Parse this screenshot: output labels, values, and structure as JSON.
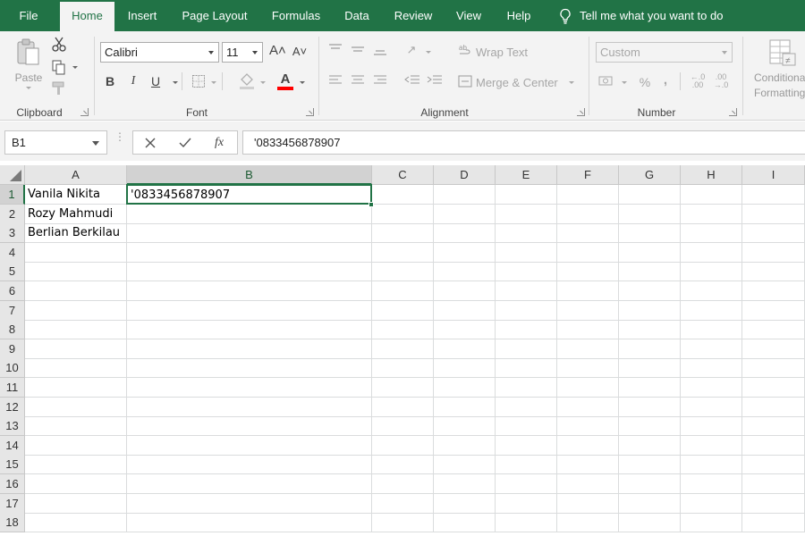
{
  "tabs": [
    {
      "label": "File",
      "active": false
    },
    {
      "label": "Home",
      "active": true
    },
    {
      "label": "Insert",
      "active": false
    },
    {
      "label": "Page Layout",
      "active": false
    },
    {
      "label": "Formulas",
      "active": false
    },
    {
      "label": "Data",
      "active": false
    },
    {
      "label": "Review",
      "active": false
    },
    {
      "label": "View",
      "active": false
    },
    {
      "label": "Help",
      "active": false
    }
  ],
  "tell_me": "Tell me what you want to do",
  "ribbon": {
    "clipboard": {
      "paste_label": "Paste",
      "group_label": "Clipboard"
    },
    "font": {
      "name": "Calibri",
      "size": "11",
      "bold": "B",
      "italic": "I",
      "underline": "U",
      "group_label": "Font",
      "font_color": "#ff0000"
    },
    "alignment": {
      "wrap_text": "Wrap Text",
      "merge_center": "Merge & Center",
      "group_label": "Alignment"
    },
    "number": {
      "format": "Custom",
      "percent": "%",
      "comma": ",",
      "group_label": "Number"
    },
    "styles": {
      "conditional_formatting_line1": "Conditional",
      "conditional_formatting_line2": "Formatting"
    }
  },
  "formula_bar": {
    "name_box": "B1",
    "fx": "fx",
    "content": "'0833456878907"
  },
  "sheet": {
    "columns": [
      "A",
      "B",
      "C",
      "D",
      "E",
      "F",
      "G",
      "H",
      "I"
    ],
    "rows": [
      "1",
      "2",
      "3",
      "4",
      "5",
      "6",
      "7",
      "8",
      "9",
      "10",
      "11",
      "12",
      "13",
      "14",
      "15",
      "16",
      "17",
      "18"
    ],
    "selected_cell": "B1",
    "cells": {
      "A1": "Vanila Nikita",
      "A2": "Rozy Mahmudi",
      "A3": "Berlian Berkilau",
      "B1": "'0833456878907"
    }
  },
  "colors": {
    "accent": "#217346",
    "ribbon_bg": "#f3f3f3",
    "header_bg": "#e6e6e6"
  }
}
